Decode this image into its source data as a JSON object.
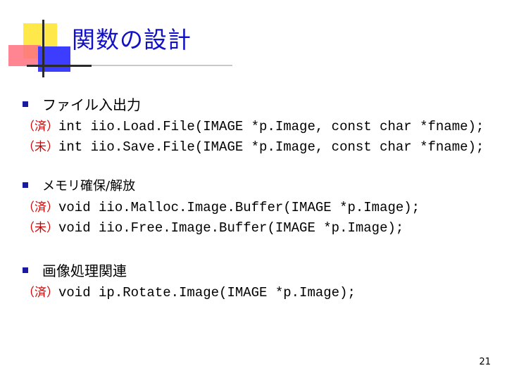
{
  "title": "関数の設計",
  "sections": [
    {
      "heading": "ファイル入出力",
      "lines": [
        {
          "tag": "（済）",
          "code": "int iio.Load.File(IMAGE *p.Image, const char *fname);"
        },
        {
          "tag": "（未）",
          "code": "int iio.Save.File(IMAGE *p.Image, const char *fname);"
        }
      ]
    },
    {
      "heading": "メモリ確保/解放",
      "lines": [
        {
          "tag": "（済）",
          "code": "void iio.Malloc.Image.Buffer(IMAGE *p.Image);"
        },
        {
          "tag": "（未）",
          "code": "void iio.Free.Image.Buffer(IMAGE *p.Image);"
        }
      ]
    },
    {
      "heading": "画像処理関連",
      "lines": [
        {
          "tag": "（済）",
          "code": "void ip.Rotate.Image(IMAGE *p.Image);"
        }
      ]
    }
  ],
  "page_number": "21",
  "colors": {
    "title": "#1010c8",
    "bullet": "#1a1aa0",
    "tag": "#d00000",
    "deco_yellow": "#ffe94a",
    "deco_blue": "#3d3dff",
    "deco_red": "#ff7080"
  }
}
